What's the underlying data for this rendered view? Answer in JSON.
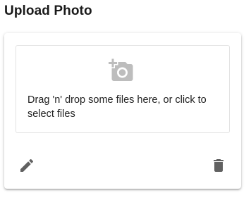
{
  "page": {
    "title": "Upload Photo"
  },
  "dropzone": {
    "icon": "add-a-photo-icon",
    "text": "Drag 'n' drop some files here, or click to select files"
  },
  "actions": {
    "edit_icon": "pencil-icon",
    "delete_icon": "trash-icon"
  },
  "colors": {
    "icon_gray": "#bdbdbd",
    "action_icon": "#616161",
    "dropzone_border": "#e3e3e3"
  }
}
